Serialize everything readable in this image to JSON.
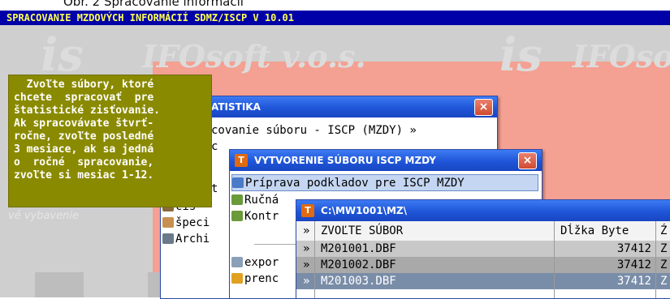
{
  "caption": "Obr. 2 Spracovanie informácií",
  "app_title": "SPRACOVANIE MZDOVÝCH INFORMÁCIÍ SDMZ/ISCP V 10.01",
  "background": {
    "logo_is": "is",
    "logo_text": "IFOsoft v.o.s.",
    "logo_text_right": "IFOso",
    "subtitle_fragment": "vé vybavenie"
  },
  "tooltip": {
    "lines": [
      "  Zvoľte súbory, ktoré",
      "chcete  spracovať  pre",
      "štatistické zisťovanie.",
      "Ak spracovávate štvrť-",
      "ročne, zvoľte posledné",
      "3 mesiace, ak sa jedná",
      "o  ročné  spracovanie,",
      "zvoľte si mesiac 1-12."
    ]
  },
  "menu_statistika": {
    "title": "ATISTIKA",
    "row1": "covanie súboru - ISCP (MZDY)  »",
    "row2": "c",
    "left_items": [
      "t",
      "cis",
      "špeci",
      "Archi"
    ],
    "items": [
      "Ručná",
      "Kontr",
      "expor",
      "prenc"
    ]
  },
  "menu_iscp": {
    "title": "VYTVORENIE SÚBORU ISCP MZDY",
    "items": [
      "Príprava podkladov pre ISCP MZDY"
    ]
  },
  "file_window": {
    "title": "C:\\MW1001\\MZ\\",
    "columns": [
      "»",
      "ZVOĽTE SÚBOR",
      "Dĺžka Byte",
      "Ź"
    ],
    "rows": [
      {
        "marker": "»",
        "name": "M201001.DBF",
        "size": "37412",
        "extra": "Z"
      },
      {
        "marker": "»",
        "name": "M201002.DBF",
        "size": "37412",
        "extra": "Z"
      },
      {
        "marker": "»",
        "name": "M201003.DBF",
        "size": "37412",
        "extra": "Z"
      }
    ]
  },
  "colors": {
    "app_bar": "#0000a8",
    "app_bar_text": "#ffff55",
    "tooltip_bg": "#8a8a00",
    "desktop": "#cfcfcf",
    "salmon": "#f4a092",
    "titlebar": "#1f55d8",
    "row_highlight": "#c8c8c8",
    "row_selected": "#7a8da8"
  }
}
